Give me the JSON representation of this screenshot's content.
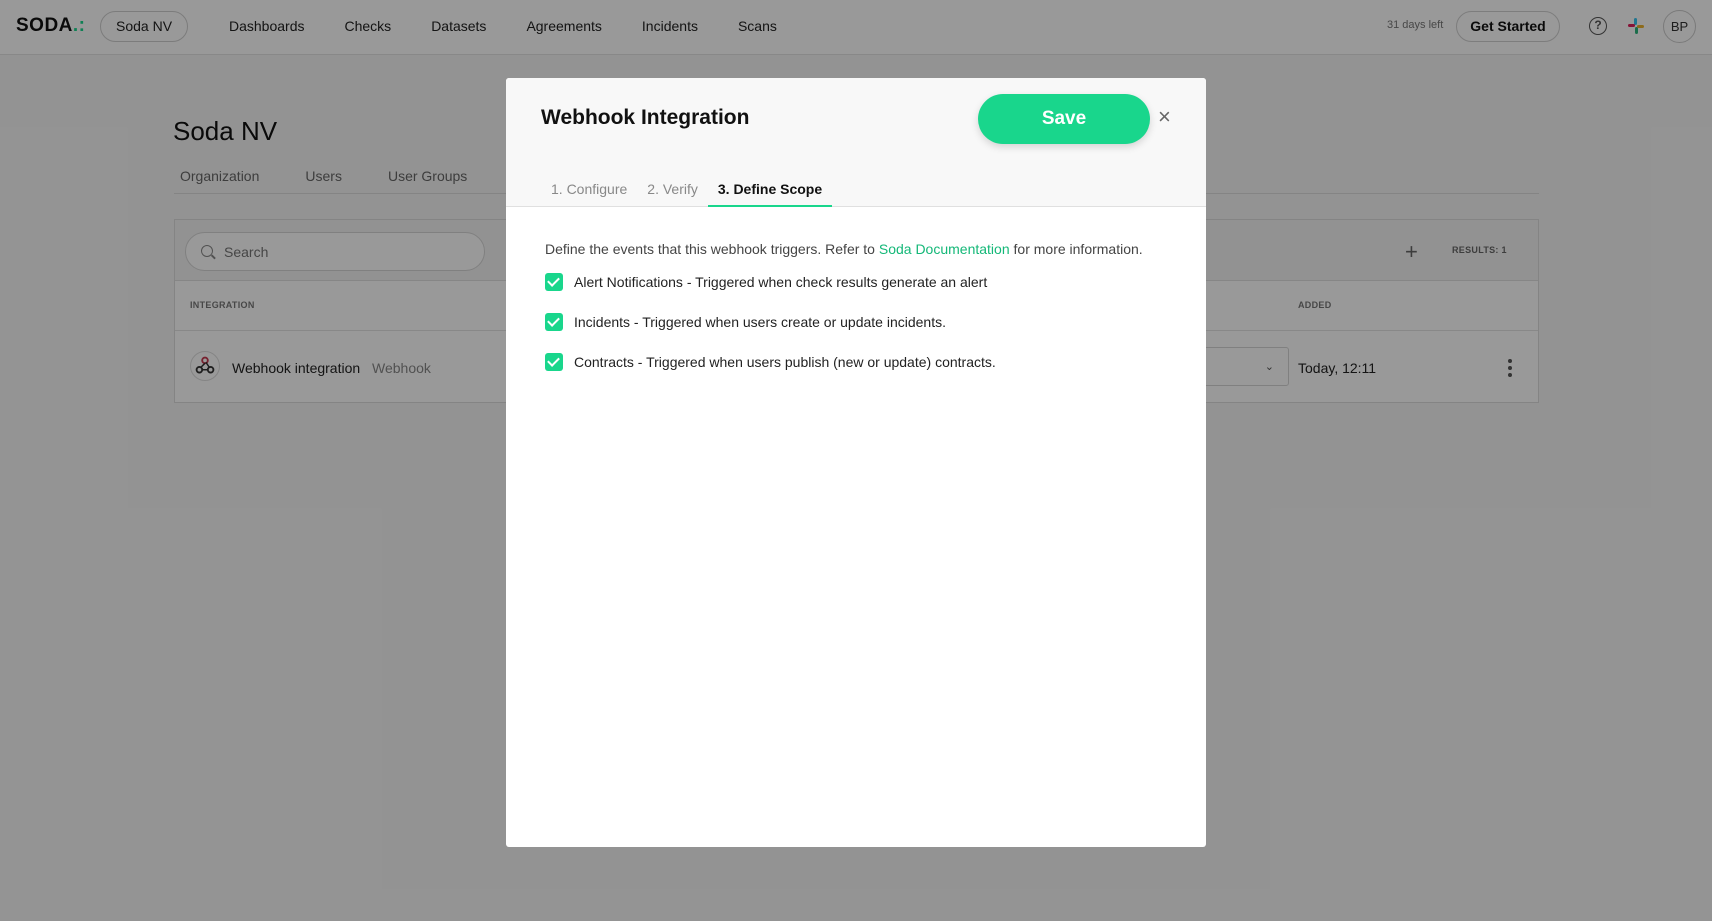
{
  "topbar": {
    "logo_text": "SODA",
    "logo_dots": ".:",
    "org_name": "Soda NV",
    "nav": [
      "Dashboards",
      "Checks",
      "Datasets",
      "Agreements",
      "Incidents",
      "Scans"
    ],
    "trial_text": "31 days left",
    "get_started": "Get Started",
    "help_glyph": "?",
    "avatar_initials": "BP"
  },
  "page": {
    "title": "Soda NV",
    "subtabs": [
      "Organization",
      "Users",
      "User Groups"
    ],
    "search_placeholder": "Search",
    "plus_glyph": "+",
    "results_label": "RESULTS:  1",
    "columns": {
      "integration": "INTEGRATION",
      "added": "ADDED"
    },
    "row": {
      "name": "Webhook integration",
      "type": "Webhook",
      "added": "Today, 12:11",
      "chevron": "⌄"
    }
  },
  "modal": {
    "title": "Webhook Integration",
    "save_label": "Save",
    "close_glyph": "×",
    "steps": [
      "1. Configure",
      "2. Verify",
      "3. Define Scope"
    ],
    "active_step": 2,
    "intro_before": "Define the events that this webhook triggers. Refer to ",
    "intro_link": "Soda Documentation",
    "intro_after": " for more information.",
    "options": [
      {
        "label": "Alert Notifications - Triggered when check results generate an alert",
        "checked": true
      },
      {
        "label": "Incidents - Triggered when users create or update incidents.",
        "checked": true
      },
      {
        "label": "Contracts - Triggered when users publish (new or update) contracts.",
        "checked": true
      }
    ]
  },
  "colors": {
    "accent": "#19d68c",
    "link": "#14b878"
  },
  "icons": [
    "search-icon",
    "plus-icon",
    "webhook-icon",
    "chevron-down-icon",
    "more-vertical-icon",
    "help-icon",
    "slack-icon",
    "close-icon",
    "check-icon"
  ]
}
